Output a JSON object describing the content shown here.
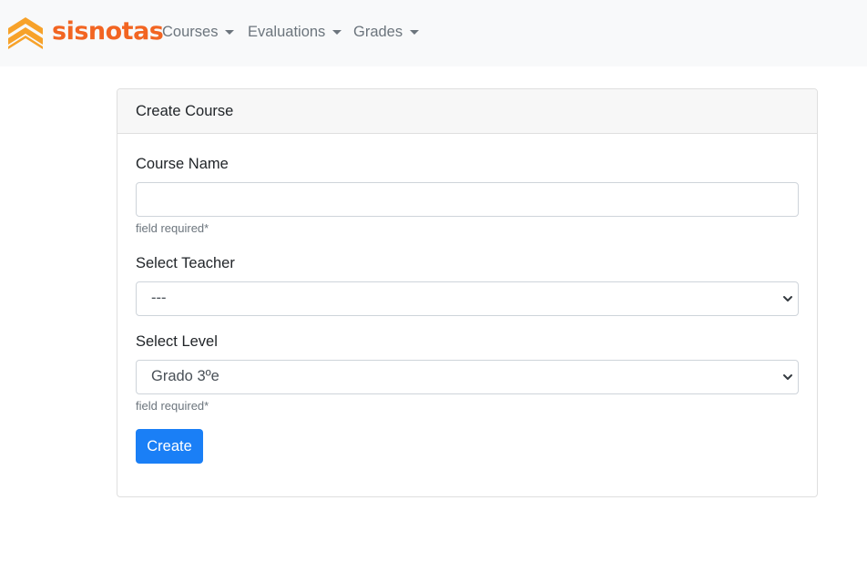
{
  "brand": {
    "name": "sisnotas",
    "logo_icon": "stacked-chevrons-icon",
    "color": "#f26522",
    "logo_color": "#f7a22a"
  },
  "nav": {
    "items": [
      {
        "label": "Courses"
      },
      {
        "label": "Evaluations"
      },
      {
        "label": "Grades"
      }
    ]
  },
  "form": {
    "title": "Create Course",
    "course_name": {
      "label": "Course Name",
      "value": "",
      "help": "field required*"
    },
    "teacher": {
      "label": "Select Teacher",
      "selected": "---"
    },
    "level": {
      "label": "Select Level",
      "selected": "Grado 3ºe",
      "help": "field required*"
    },
    "submit_label": "Create"
  },
  "colors": {
    "primary": "#1a7ff6",
    "navbar_bg": "#f8f9fa",
    "muted": "#6c757d"
  }
}
